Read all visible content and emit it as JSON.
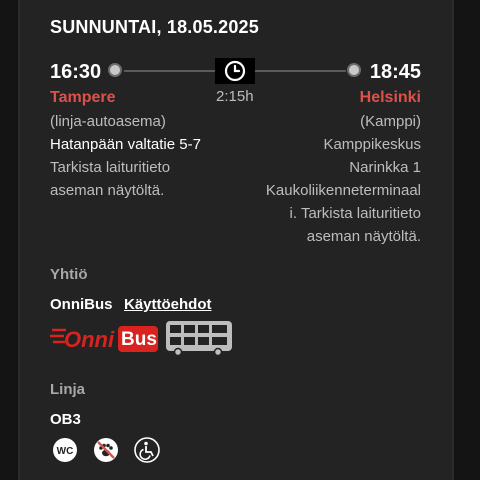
{
  "date": "SUNNUNTAI, 18.05.2025",
  "departure": {
    "time": "16:30",
    "city": "Tampere",
    "station": "(linja-autoasema)",
    "address": "Hatanpään valtatie 5-7",
    "note_line1": "Tarkista laituritieto",
    "note_line2": "aseman näytöltä."
  },
  "arrival": {
    "time": "18:45",
    "city": "Helsinki",
    "lines": [
      "(Kamppi)",
      "Kamppikeskus",
      "Narinkka 1",
      "Kaukoliikenneterminaal",
      "i. Tarkista laituritieto",
      "aseman näytöltä."
    ]
  },
  "duration": "2:15h",
  "company": {
    "heading": "Yhtiö",
    "name": "OnniBus",
    "terms_link": "Käyttöehdot",
    "logo_text_a": "Onni",
    "logo_text_b": "Bus"
  },
  "route": {
    "heading": "Linja",
    "code": "OB3",
    "amenities": [
      "wc-icon",
      "no-pets-icon",
      "wheelchair-icon"
    ],
    "wc_label": "WC"
  },
  "colors": {
    "accent_red": "#e0504a",
    "background": "#232323"
  }
}
